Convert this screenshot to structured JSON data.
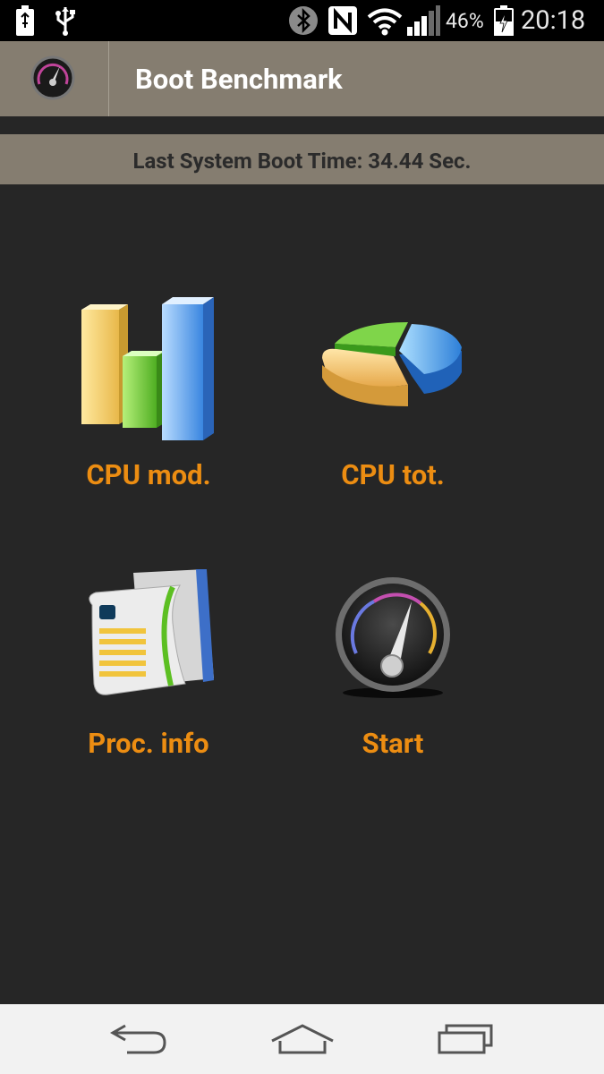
{
  "status_bar": {
    "battery_percent": "46%",
    "time": "20:18",
    "icons": [
      "battery-charging-icon",
      "usb-icon",
      "bluetooth-icon",
      "nfc-icon",
      "wifi-icon",
      "cell-signal-icon",
      "battery-icon"
    ]
  },
  "action_bar": {
    "title": "Boot Benchmark",
    "icon": "speedometer-icon"
  },
  "info_band": {
    "text": "Last System Boot Time: 34.44 Sec."
  },
  "tiles": [
    {
      "label": "CPU mod.",
      "icon": "bar-chart-icon"
    },
    {
      "label": "CPU tot.",
      "icon": "pie-chart-icon"
    },
    {
      "label": "Proc. info",
      "icon": "document-icon"
    },
    {
      "label": "Start",
      "icon": "speedometer-icon"
    }
  ],
  "nav_bar": {
    "icons": [
      "back-icon",
      "home-icon",
      "recent-apps-icon"
    ]
  },
  "colors": {
    "background": "#262626",
    "bar": "#857d70",
    "accent_label": "#ec8d12"
  }
}
